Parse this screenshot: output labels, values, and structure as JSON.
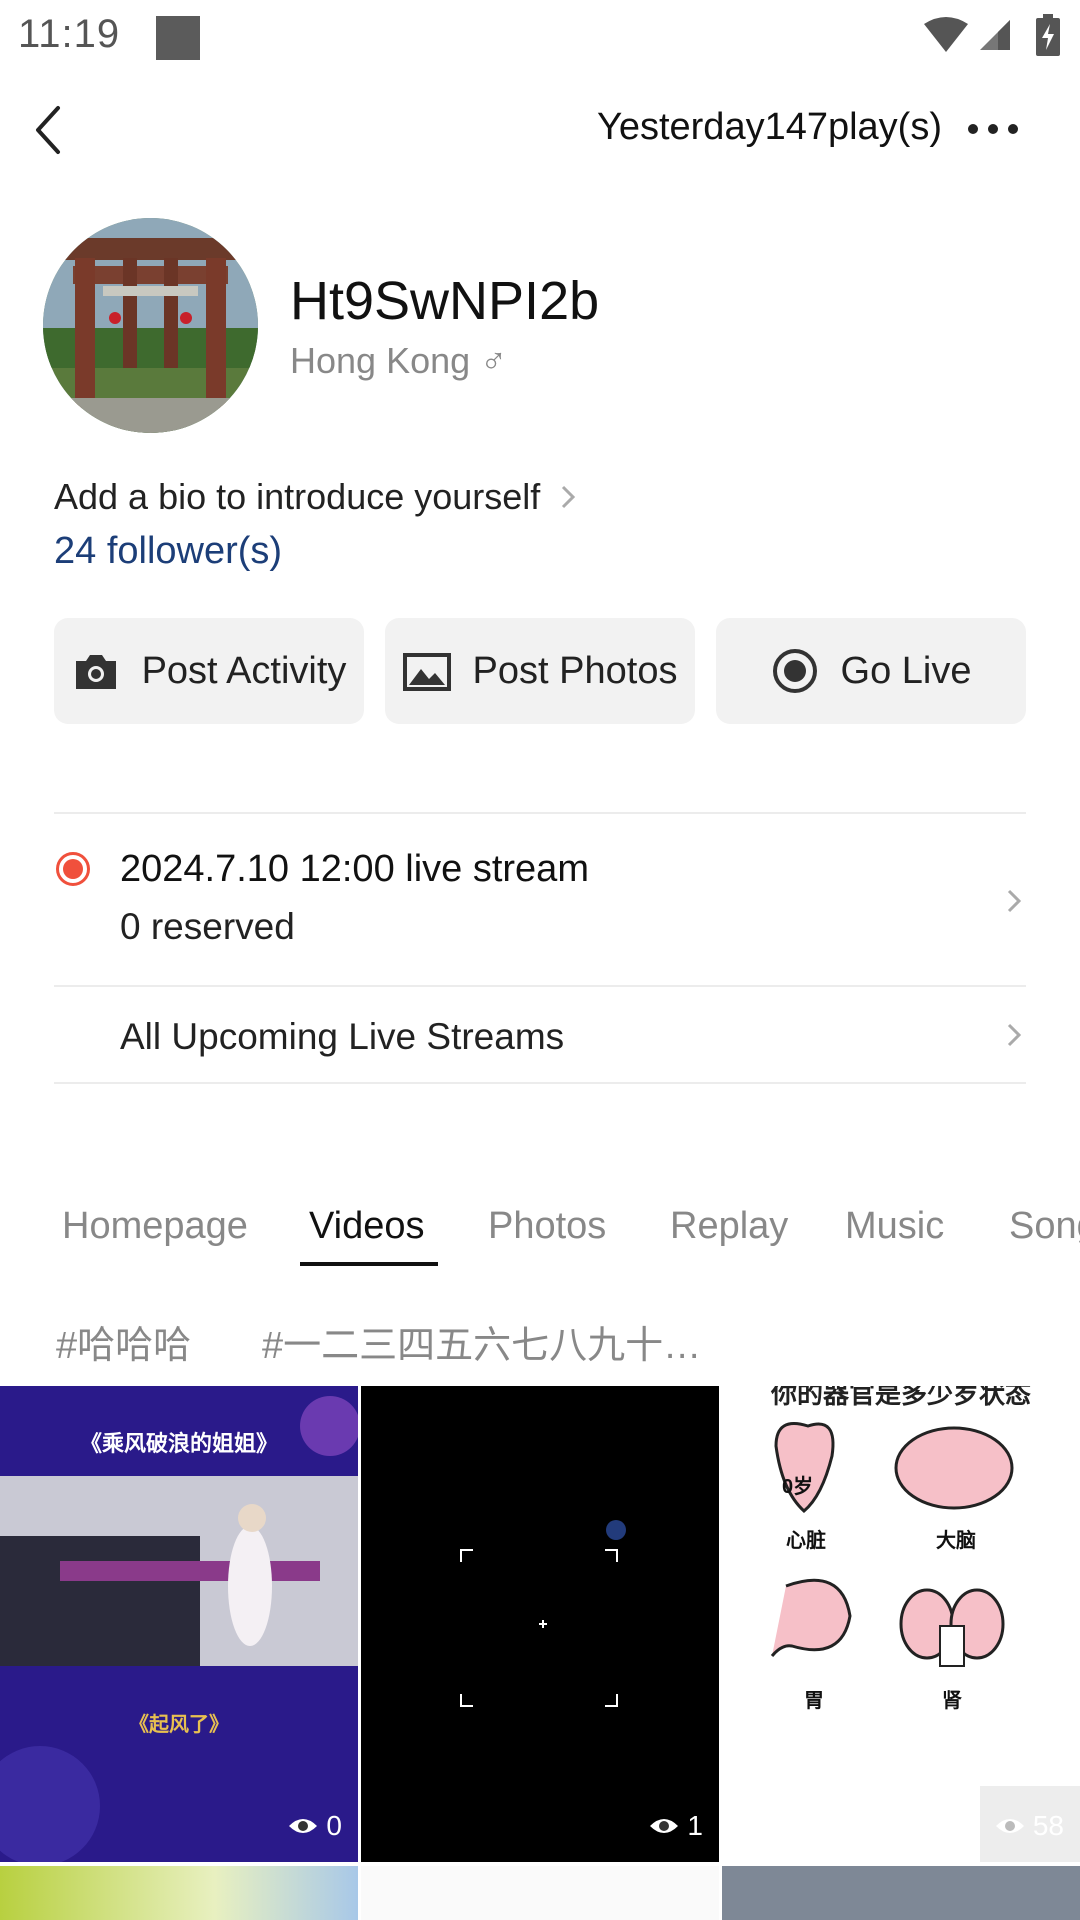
{
  "status_bar": {
    "time": "11:19"
  },
  "header": {
    "plays": "Yesterday147play(s)"
  },
  "profile": {
    "username": "Ht9SwNPI2b",
    "location": "Hong Kong ♂",
    "bio_prompt": "Add a bio to introduce yourself",
    "followers": "24 follower(s)"
  },
  "actions": [
    {
      "label": "Post Activity",
      "icon": "camera-icon"
    },
    {
      "label": "Post Photos",
      "icon": "image-icon"
    },
    {
      "label": "Go Live",
      "icon": "record-icon"
    }
  ],
  "live": {
    "title": "2024.7.10 12:00 live stream",
    "reserved": "0 reserved",
    "all_upcoming": "All Upcoming Live Streams"
  },
  "tabs": [
    "Homepage",
    "Videos",
    "Photos",
    "Replay",
    "Music",
    "Songs"
  ],
  "active_tab": "Videos",
  "tags": [
    "#哈哈哈",
    "#一二三四五六七八九十…"
  ],
  "videos": [
    {
      "views": "0",
      "top_caption": "《乘风破浪的姐姐》",
      "bottom_caption": "《起风了》"
    },
    {
      "views": "1"
    },
    {
      "views": "58",
      "header": "你的器官是多少岁状态",
      "labels": [
        "0岁",
        "心脏",
        "大脑",
        "胃",
        "肾"
      ]
    }
  ],
  "colors": {
    "accent_live": "#f0503c",
    "followers_link": "#1c3e78",
    "button_bg": "#f2f2f2"
  }
}
